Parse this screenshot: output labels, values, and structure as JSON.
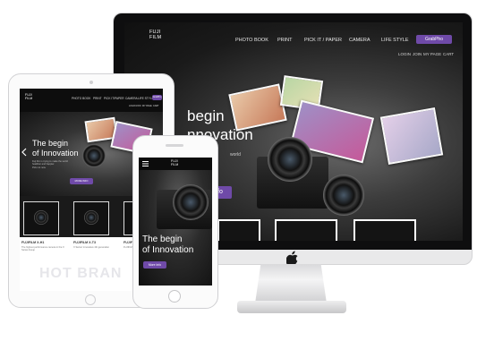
{
  "site": {
    "logo_line1": "FUJI",
    "logo_line2": "FILM"
  },
  "desktop": {
    "nav": [
      "PHOTO BOOK",
      "PRINT",
      "PICK IT / PAPER",
      "CAMERA",
      "LIFE STYLE"
    ],
    "nav_cta": "GrabPho",
    "utility": [
      "LOGIN",
      "JOIN",
      "MY PAGE",
      "CART"
    ],
    "hero_line1": "begin",
    "hero_line2": "nnovation",
    "hero_sub": "world",
    "hero_button": "ore Info"
  },
  "tablet": {
    "nav": [
      "PHOTO BOOK",
      "PRINT",
      "PICK IT/PAPER",
      "CAMERA",
      "LIFE STYLE"
    ],
    "nav_cta": "GrabPho",
    "utility": [
      "LOGIN",
      "JOIN",
      "MY PAGE",
      "CART"
    ],
    "hero_line1": "The begin",
    "hero_line2": "of Innovation",
    "hero_sub1": "Fuji film is trying to make the world",
    "hero_sub2": "healthier and happier.",
    "hero_sub3": "Pick not now.",
    "hero_button": "MORE INFO",
    "products": [
      {
        "name": "FUJIFILM X-H1",
        "desc": "The highest performance camera in the X Series lineup"
      },
      {
        "name": "FUJIFILM X-T3",
        "desc": "X Series' innovative 4th generation"
      },
      {
        "name": "FUJIFILM X-T",
        "desc": "FUJIFILM X-T100 enables everybody"
      }
    ],
    "brand_text": "HOT  BRAN"
  },
  "phone": {
    "hero_line1": "The begin",
    "hero_line2": "of Innovation",
    "hero_button": "More Info"
  },
  "colors": {
    "accent": "#6f4aa8",
    "dark": "#0e0e0f",
    "device_silver": "#e9e9ea"
  },
  "icons": [
    "apple-logo-icon",
    "hamburger-menu-icon",
    "chevron-left-icon"
  ]
}
